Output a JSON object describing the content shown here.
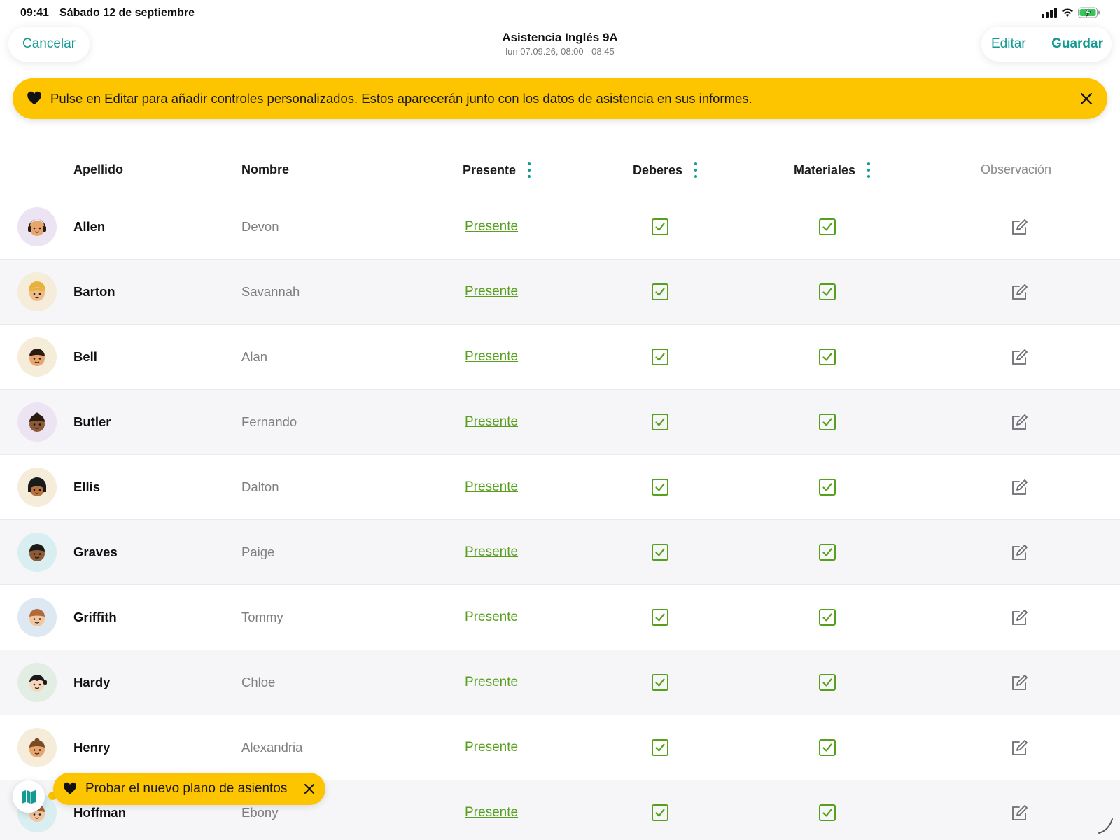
{
  "status_bar": {
    "time": "09:41",
    "date": "Sábado 12 de septiembre",
    "icons": [
      "signal-icon",
      "wifi-icon",
      "battery-charging-icon"
    ]
  },
  "header": {
    "cancel_label": "Cancelar",
    "title": "Asistencia Inglés 9A",
    "subtitle": "lun 07.09.26, 08:00 - 08:45",
    "edit_label": "Editar",
    "save_label": "Guardar"
  },
  "banner": {
    "text": "Pulse en Editar para añadir controles personalizados. Estos aparecerán junto con los datos de asistencia en sus informes.",
    "icon": "heart-icon",
    "color": "#fdc500"
  },
  "table": {
    "columns": {
      "last_name": "Apellido",
      "first_name": "Nombre",
      "present": "Presente",
      "homework": "Deberes",
      "materials": "Materiales",
      "observation": "Observación"
    },
    "rows": [
      {
        "last": "Allen",
        "first": "Devon",
        "presence": "Presente",
        "homework": true,
        "materials": true
      },
      {
        "last": "Barton",
        "first": "Savannah",
        "presence": "Presente",
        "homework": true,
        "materials": true
      },
      {
        "last": "Bell",
        "first": "Alan",
        "presence": "Presente",
        "homework": true,
        "materials": true
      },
      {
        "last": "Butler",
        "first": "Fernando",
        "presence": "Presente",
        "homework": true,
        "materials": true
      },
      {
        "last": "Ellis",
        "first": "Dalton",
        "presence": "Presente",
        "homework": true,
        "materials": true
      },
      {
        "last": "Graves",
        "first": "Paige",
        "presence": "Presente",
        "homework": true,
        "materials": true
      },
      {
        "last": "Griffith",
        "first": "Tommy",
        "presence": "Presente",
        "homework": true,
        "materials": true
      },
      {
        "last": "Hardy",
        "first": "Chloe",
        "presence": "Presente",
        "homework": true,
        "materials": true
      },
      {
        "last": "Henry",
        "first": "Alexandria",
        "presence": "Presente",
        "homework": true,
        "materials": true
      },
      {
        "last": "Hoffman",
        "first": "Ebony",
        "presence": "Presente",
        "homework": true,
        "materials": true
      }
    ]
  },
  "seating_chip": {
    "text": "Probar el nuevo plano de asientos",
    "icon": "seating-map-icon"
  },
  "colors": {
    "accent": "#139a93",
    "present_green": "#57a01e",
    "banner_yellow": "#fdc500"
  }
}
